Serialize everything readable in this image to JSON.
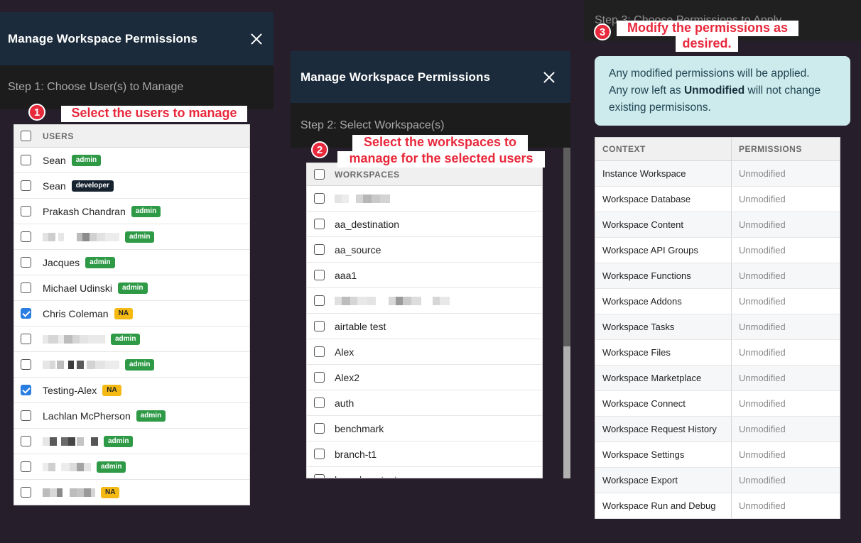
{
  "panel1": {
    "title": "Manage Workspace Permissions",
    "step": "Step 1: Choose User(s) to Manage",
    "header": "USERS",
    "rows": [
      {
        "name": "Sean",
        "badge": "admin",
        "checked": false
      },
      {
        "name": "Sean",
        "badge": "developer",
        "checked": false
      },
      {
        "name": "Prakash Chandran",
        "badge": "admin",
        "checked": false
      },
      {
        "name": "",
        "badge": "admin",
        "checked": false,
        "blur": [
          [
            0,
            8,
            "#e2e2e2"
          ],
          [
            8,
            10,
            "#cdcdcd"
          ],
          [
            22,
            8,
            "#e6e6e6"
          ],
          [
            48,
            8,
            "#bcbcbc"
          ],
          [
            56,
            10,
            "#8c8c8c"
          ],
          [
            66,
            10,
            "#d0d0d0"
          ],
          [
            76,
            12,
            "#e2e2e2"
          ],
          [
            88,
            20,
            "#ececec"
          ]
        ]
      },
      {
        "name": "Jacques",
        "badge": "admin",
        "checked": false
      },
      {
        "name": "Michael Udinski",
        "badge": "admin",
        "checked": false
      },
      {
        "name": "Chris Coleman",
        "badge": "NA",
        "checked": true
      },
      {
        "name": "",
        "badge": "admin",
        "checked": false,
        "blur": [
          [
            0,
            8,
            "#e8e8e8"
          ],
          [
            8,
            14,
            "#d6d6d6"
          ],
          [
            22,
            8,
            "#ececec"
          ],
          [
            30,
            12,
            "#bdbdbd"
          ],
          [
            42,
            10,
            "#d5d5d5"
          ],
          [
            52,
            12,
            "#e4e4e4"
          ],
          [
            64,
            24,
            "#e9e9e9"
          ]
        ]
      },
      {
        "name": "",
        "badge": "admin",
        "checked": false,
        "blur": [
          [
            0,
            10,
            "#e6e6e6"
          ],
          [
            10,
            8,
            "#d8d8d8"
          ],
          [
            20,
            10,
            "#bdbdbd"
          ],
          [
            36,
            8,
            "#3c3c3c"
          ],
          [
            48,
            10,
            "#5a5a5a"
          ],
          [
            62,
            12,
            "#d2d2d2"
          ],
          [
            74,
            14,
            "#e4e4e4"
          ],
          [
            88,
            20,
            "#ececec"
          ]
        ]
      },
      {
        "name": "Testing-Alex",
        "badge": "NA",
        "checked": true
      },
      {
        "name": "Lachlan McPherson",
        "badge": "admin",
        "checked": false
      },
      {
        "name": "",
        "badge": "admin",
        "checked": false,
        "blur": [
          [
            0,
            10,
            "#e6e6e6"
          ],
          [
            10,
            10,
            "#5a5a5a"
          ],
          [
            26,
            10,
            "#6a6a6a"
          ],
          [
            36,
            10,
            "#454545"
          ],
          [
            48,
            10,
            "#c4c4c4"
          ],
          [
            68,
            10,
            "#555555"
          ]
        ]
      },
      {
        "name": "",
        "badge": "admin",
        "checked": false,
        "blur": [
          [
            0,
            8,
            "#ececec"
          ],
          [
            8,
            10,
            "#cfcfcf"
          ],
          [
            26,
            12,
            "#ececec"
          ],
          [
            38,
            10,
            "#dcdcdc"
          ],
          [
            48,
            10,
            "#a3a3a3"
          ],
          [
            58,
            10,
            "#e4e4e4"
          ]
        ]
      },
      {
        "name": "",
        "badge": "NA",
        "checked": false,
        "blur": [
          [
            0,
            10,
            "#bcbcbc"
          ],
          [
            10,
            10,
            "#d8d8d8"
          ],
          [
            20,
            8,
            "#8a8a8a"
          ],
          [
            38,
            10,
            "#bdbdbd"
          ],
          [
            48,
            10,
            "#c4c4c4"
          ],
          [
            58,
            10,
            "#9a9a9a"
          ],
          [
            68,
            6,
            "#d5d5d5"
          ]
        ]
      }
    ]
  },
  "panel2": {
    "title": "Manage Workspace Permissions",
    "step": "Step 2: Select Workspace(s)",
    "header": "WORKSPACES",
    "rows": [
      {
        "name": "",
        "blur": [
          [
            0,
            10,
            "#e4e4e4"
          ],
          [
            10,
            10,
            "#ececec"
          ],
          [
            30,
            10,
            "#d4d4d4"
          ],
          [
            40,
            12,
            "#b6b6b6"
          ],
          [
            52,
            12,
            "#c9c9c9"
          ],
          [
            64,
            14,
            "#d3d3d3"
          ]
        ]
      },
      {
        "name": "aa_destination"
      },
      {
        "name": "aa_source"
      },
      {
        "name": "aaa1"
      },
      {
        "name": "",
        "blur": [
          [
            0,
            10,
            "#e0e0e0"
          ],
          [
            10,
            12,
            "#bdbdbd"
          ],
          [
            22,
            10,
            "#d6d6d6"
          ],
          [
            32,
            14,
            "#e8e8e8"
          ],
          [
            46,
            12,
            "#e4e4e4"
          ],
          [
            76,
            10,
            "#d8d8d8"
          ],
          [
            86,
            10,
            "#9a9a9a"
          ],
          [
            96,
            12,
            "#c9c9c9"
          ],
          [
            108,
            14,
            "#dddddd"
          ],
          [
            138,
            10,
            "#d6d6d6"
          ],
          [
            148,
            14,
            "#e8e8e8"
          ]
        ]
      },
      {
        "name": "airtable test"
      },
      {
        "name": "Alex"
      },
      {
        "name": "Alex2"
      },
      {
        "name": "auth"
      },
      {
        "name": "benchmark"
      },
      {
        "name": "branch-t1"
      },
      {
        "name": "branches_test"
      }
    ]
  },
  "panel3": {
    "step": "Step 3: Choose Permissions to Apply",
    "info_line1": "Any modified permissions will be applied.",
    "info_line2_pre": "Any row left as ",
    "info_line2_bold": "Unmodified",
    "info_line2_post": " will not change",
    "info_line3": "existing permisisons.",
    "col_context": "CONTEXT",
    "col_permissions": "PERMISSIONS",
    "rows": [
      {
        "context": "Instance Workspace",
        "permission": "Unmodified"
      },
      {
        "context": "Workspace Database",
        "permission": "Unmodified"
      },
      {
        "context": "Workspace Content",
        "permission": "Unmodified"
      },
      {
        "context": "Workspace API Groups",
        "permission": "Unmodified"
      },
      {
        "context": "Workspace Functions",
        "permission": "Unmodified"
      },
      {
        "context": "Workspace Addons",
        "permission": "Unmodified"
      },
      {
        "context": "Workspace Tasks",
        "permission": "Unmodified"
      },
      {
        "context": "Workspace Files",
        "permission": "Unmodified"
      },
      {
        "context": "Workspace Marketplace",
        "permission": "Unmodified"
      },
      {
        "context": "Workspace Connect",
        "permission": "Unmodified"
      },
      {
        "context": "Workspace Request History",
        "permission": "Unmodified"
      },
      {
        "context": "Workspace Settings",
        "permission": "Unmodified"
      },
      {
        "context": "Workspace Export",
        "permission": "Unmodified"
      },
      {
        "context": "Workspace Run and Debug",
        "permission": "Unmodified"
      }
    ]
  },
  "annotations": {
    "n1": "1",
    "t1": "Select the users to manage",
    "n2": "2",
    "t2a": "Select the workspaces to",
    "t2b": "manage for the selected users",
    "n3": "3",
    "t3a": "Modify the permissions as",
    "t3b": "desired."
  },
  "colors": {
    "background": "#261e2b",
    "header": "#1b2b3b",
    "admin": "#2e9a46",
    "developer": "#16232f",
    "na": "#f5b914",
    "annotation": "#e8283b",
    "info_bg": "#cdeaec"
  }
}
